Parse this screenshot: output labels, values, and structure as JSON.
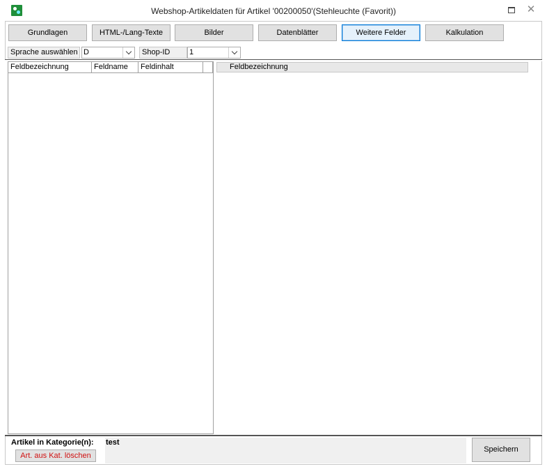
{
  "window": {
    "title": "Webshop-Artikeldaten für Artikel '00200050'(Stehleuchte  (Favorit))",
    "maximize_glyph": "",
    "close_glyph": "✕"
  },
  "tabs": [
    {
      "label": "Grundlagen",
      "active": false
    },
    {
      "label": "HTML-/Lang-Texte",
      "active": false
    },
    {
      "label": "Bilder",
      "active": false
    },
    {
      "label": "Datenblätter",
      "active": false
    },
    {
      "label": "Weitere Felder",
      "active": true
    },
    {
      "label": "Kalkulation",
      "active": false
    }
  ],
  "filters": {
    "language_label": "Sprache auswählen",
    "language_value": "D",
    "shop_label": "Shop-ID",
    "shop_value": "1"
  },
  "left_grid": {
    "columns": [
      "Feldbezeichnung",
      "Feldname",
      "Feldinhalt"
    ]
  },
  "right_grid": {
    "columns": [
      "Feldbezeichnung"
    ]
  },
  "footer": {
    "category_label": "Artikel in Kategorie(n):",
    "category_value": "test",
    "delete_label": "Art. aus Kat. löschen",
    "save_label": "Speichern"
  },
  "colors": {
    "active_tab_border": "#0078d7",
    "delete_text": "#d01010",
    "app_icon": "#1f8f3a"
  }
}
